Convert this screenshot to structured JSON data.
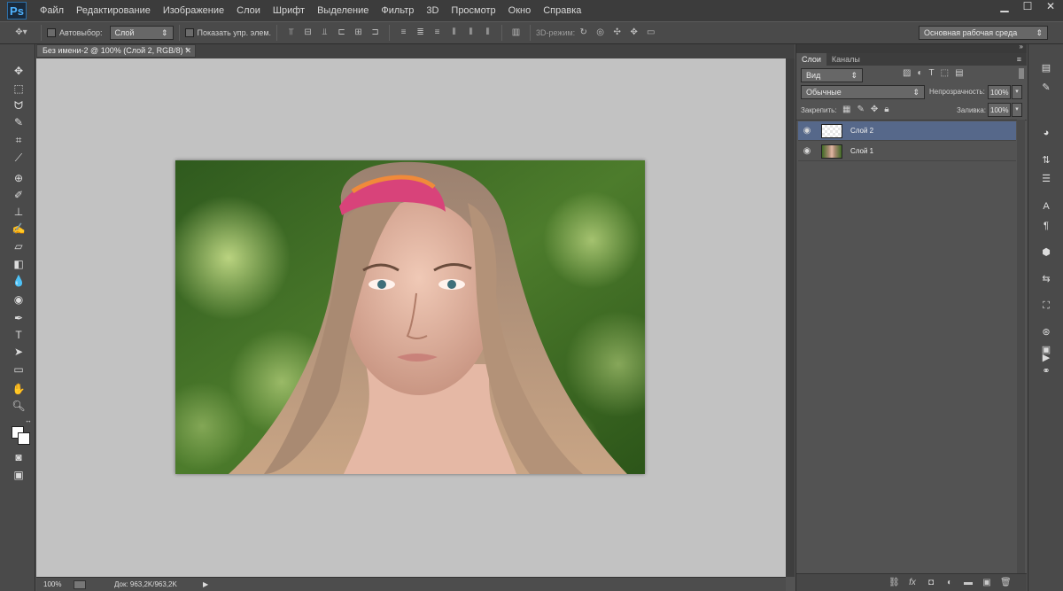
{
  "app": {
    "logo": "Ps"
  },
  "menu": [
    "Файл",
    "Редактирование",
    "Изображение",
    "Слои",
    "Шрифт",
    "Выделение",
    "Фильтр",
    "3D",
    "Просмотр",
    "Окно",
    "Справка"
  ],
  "options": {
    "autoselect_label": "Автовыбор:",
    "autoselect_value": "Слой",
    "show_transform_label": "Показать упр. элем.",
    "mode3d_label": "3D-режим:",
    "workspace_value": "Основная рабочая среда"
  },
  "document": {
    "tab_title": "Без имени-2 @ 100% (Слой 2, RGB/8) *",
    "zoom": "100%",
    "doc_info": "Док: 963,2K/963,2K"
  },
  "layers_panel": {
    "tab_layers": "Слои",
    "tab_channels": "Каналы",
    "filter_value": "Вид",
    "blend_mode": "Обычные",
    "opacity_label": "Непрозрачность:",
    "opacity_value": "100%",
    "lock_label": "Закрепить:",
    "fill_label": "Заливка:",
    "fill_value": "100%",
    "layers": [
      {
        "name": "Слой 2",
        "selected": true
      },
      {
        "name": "Слой 1",
        "selected": false
      }
    ]
  },
  "colors": {
    "accent_selected_layer": "#56688a",
    "canvas_bg": "#c2c2c2",
    "ps_blue": "#4fb3ff"
  }
}
